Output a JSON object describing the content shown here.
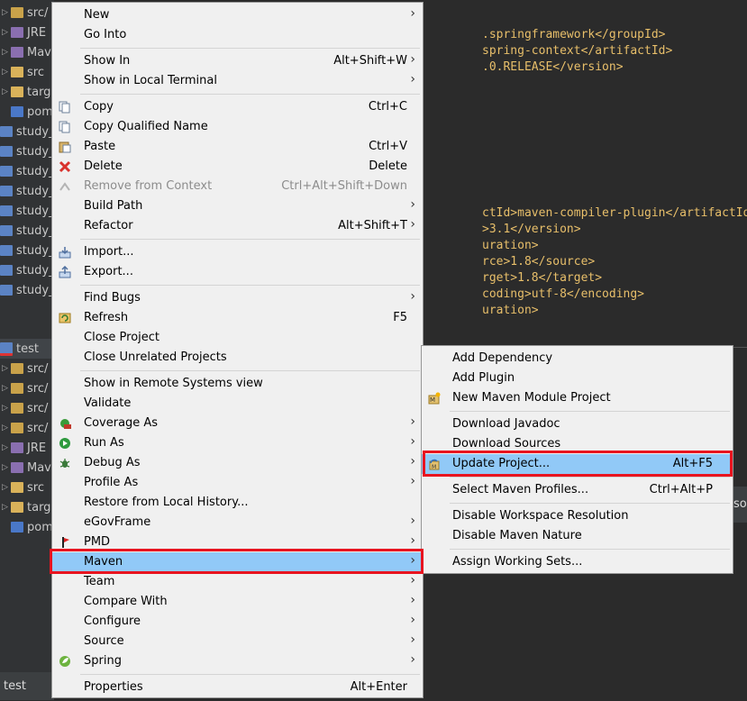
{
  "tree": {
    "rows": [
      "src/",
      "JRE",
      "Mav",
      "src",
      "targ",
      "pom",
      "study_",
      "study_",
      "study_",
      "study_",
      "study_",
      "study_",
      "study_",
      "study_",
      "study_",
      "test",
      "src/",
      "src/",
      "src/",
      "src/",
      "JRE",
      "Mav",
      "src",
      "targ",
      "pom"
    ]
  },
  "status": {
    "text": "test"
  },
  "editor": {
    "lines": [
      ".springframework</groupId>",
      "spring-context</artifactId>",
      ".0.RELEASE</version>",
      "ctId>maven-compiler-plugin</artifactId>",
      ">3.1</version>",
      "uration>",
      "rce>1.8</source>",
      "rget>1.8</target>",
      "coding>utf-8</encoding>",
      "uration>"
    ],
    "right_fragment": "so"
  },
  "context_menu": {
    "items": [
      {
        "label": "New",
        "submenu": true,
        "icon": ""
      },
      {
        "label": "Go Into",
        "icon": ""
      },
      {
        "label": "Show In",
        "shortcut": "Alt+Shift+W",
        "submenu": true,
        "icon": ""
      },
      {
        "label": "Show in Local Terminal",
        "submenu": true,
        "icon": ""
      },
      {
        "label": "Copy",
        "shortcut": "Ctrl+C",
        "icon": "copy-icon"
      },
      {
        "label": "Copy Qualified Name",
        "icon": "copy-qualified-icon"
      },
      {
        "label": "Paste",
        "shortcut": "Ctrl+V",
        "icon": "paste-icon"
      },
      {
        "label": "Delete",
        "shortcut": "Delete",
        "icon": "delete-icon"
      },
      {
        "label": "Remove from Context",
        "shortcut": "Ctrl+Alt+Shift+Down",
        "disabled": true,
        "icon": "remove-context-icon"
      },
      {
        "label": "Build Path",
        "submenu": true,
        "icon": ""
      },
      {
        "label": "Refactor",
        "shortcut": "Alt+Shift+T",
        "submenu": true,
        "icon": ""
      },
      {
        "label": "Import...",
        "icon": "import-icon"
      },
      {
        "label": "Export...",
        "icon": "export-icon"
      },
      {
        "label": "Find Bugs",
        "submenu": true,
        "icon": ""
      },
      {
        "label": "Refresh",
        "shortcut": "F5",
        "icon": "refresh-icon"
      },
      {
        "label": "Close Project",
        "icon": ""
      },
      {
        "label": "Close Unrelated Projects",
        "icon": ""
      },
      {
        "label": "Show in Remote Systems view",
        "icon": ""
      },
      {
        "label": "Validate",
        "icon": ""
      },
      {
        "label": "Coverage As",
        "submenu": true,
        "icon": "coverage-icon"
      },
      {
        "label": "Run As",
        "submenu": true,
        "icon": "run-icon"
      },
      {
        "label": "Debug As",
        "submenu": true,
        "icon": "debug-icon"
      },
      {
        "label": "Profile As",
        "submenu": true,
        "icon": ""
      },
      {
        "label": "Restore from Local History...",
        "icon": ""
      },
      {
        "label": "eGovFrame",
        "submenu": true,
        "icon": ""
      },
      {
        "label": "PMD",
        "submenu": true,
        "icon": "pmd-icon"
      },
      {
        "label": "Maven",
        "submenu": true,
        "highlighted": true,
        "icon": ""
      },
      {
        "label": "Team",
        "submenu": true,
        "icon": ""
      },
      {
        "label": "Compare With",
        "submenu": true,
        "icon": ""
      },
      {
        "label": "Configure",
        "submenu": true,
        "icon": ""
      },
      {
        "label": "Source",
        "submenu": true,
        "icon": ""
      },
      {
        "label": "Spring",
        "submenu": true,
        "icon": "spring-icon"
      },
      {
        "label": "Properties",
        "shortcut": "Alt+Enter",
        "icon": ""
      }
    ]
  },
  "maven_submenu": {
    "items": [
      {
        "label": "Add Dependency",
        "icon": ""
      },
      {
        "label": "Add Plugin",
        "icon": ""
      },
      {
        "label": "New Maven Module Project",
        "icon": "maven-module-icon"
      },
      {
        "label": "Download Javadoc",
        "icon": ""
      },
      {
        "label": "Download Sources",
        "icon": ""
      },
      {
        "label": "Update Project...",
        "shortcut": "Alt+F5",
        "highlighted": true,
        "icon": "maven-update-icon"
      },
      {
        "label": "Select Maven Profiles...",
        "shortcut": "Ctrl+Alt+P",
        "icon": ""
      },
      {
        "label": "Disable Workspace Resolution",
        "icon": ""
      },
      {
        "label": "Disable Maven Nature",
        "icon": ""
      },
      {
        "label": "Assign Working Sets...",
        "icon": ""
      }
    ]
  },
  "colors": {
    "menu_bg": "#f0f0f0",
    "highlight": "#91c9f7",
    "annotation_red": "#e8141f",
    "ide_bg": "#2b2b2b"
  }
}
